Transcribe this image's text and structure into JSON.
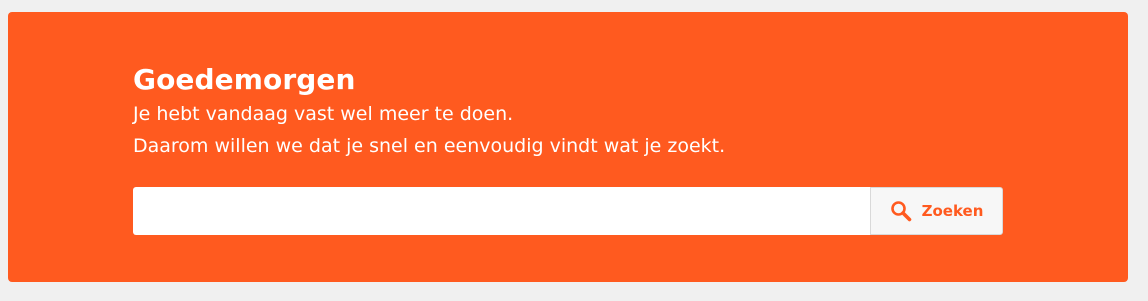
{
  "hero": {
    "title": "Goedemorgen",
    "line1": "Je hebt vandaag vast wel meer te doen.",
    "line2": "Daarom willen we dat je snel en eenvoudig vindt wat je zoekt."
  },
  "search": {
    "value": "",
    "placeholder": "",
    "button_label": "Zoeken",
    "button_icon": "search-icon"
  },
  "colors": {
    "brand": "#ff5a1f",
    "background": "#f0f0f0",
    "text_on_brand": "#ffffff"
  }
}
